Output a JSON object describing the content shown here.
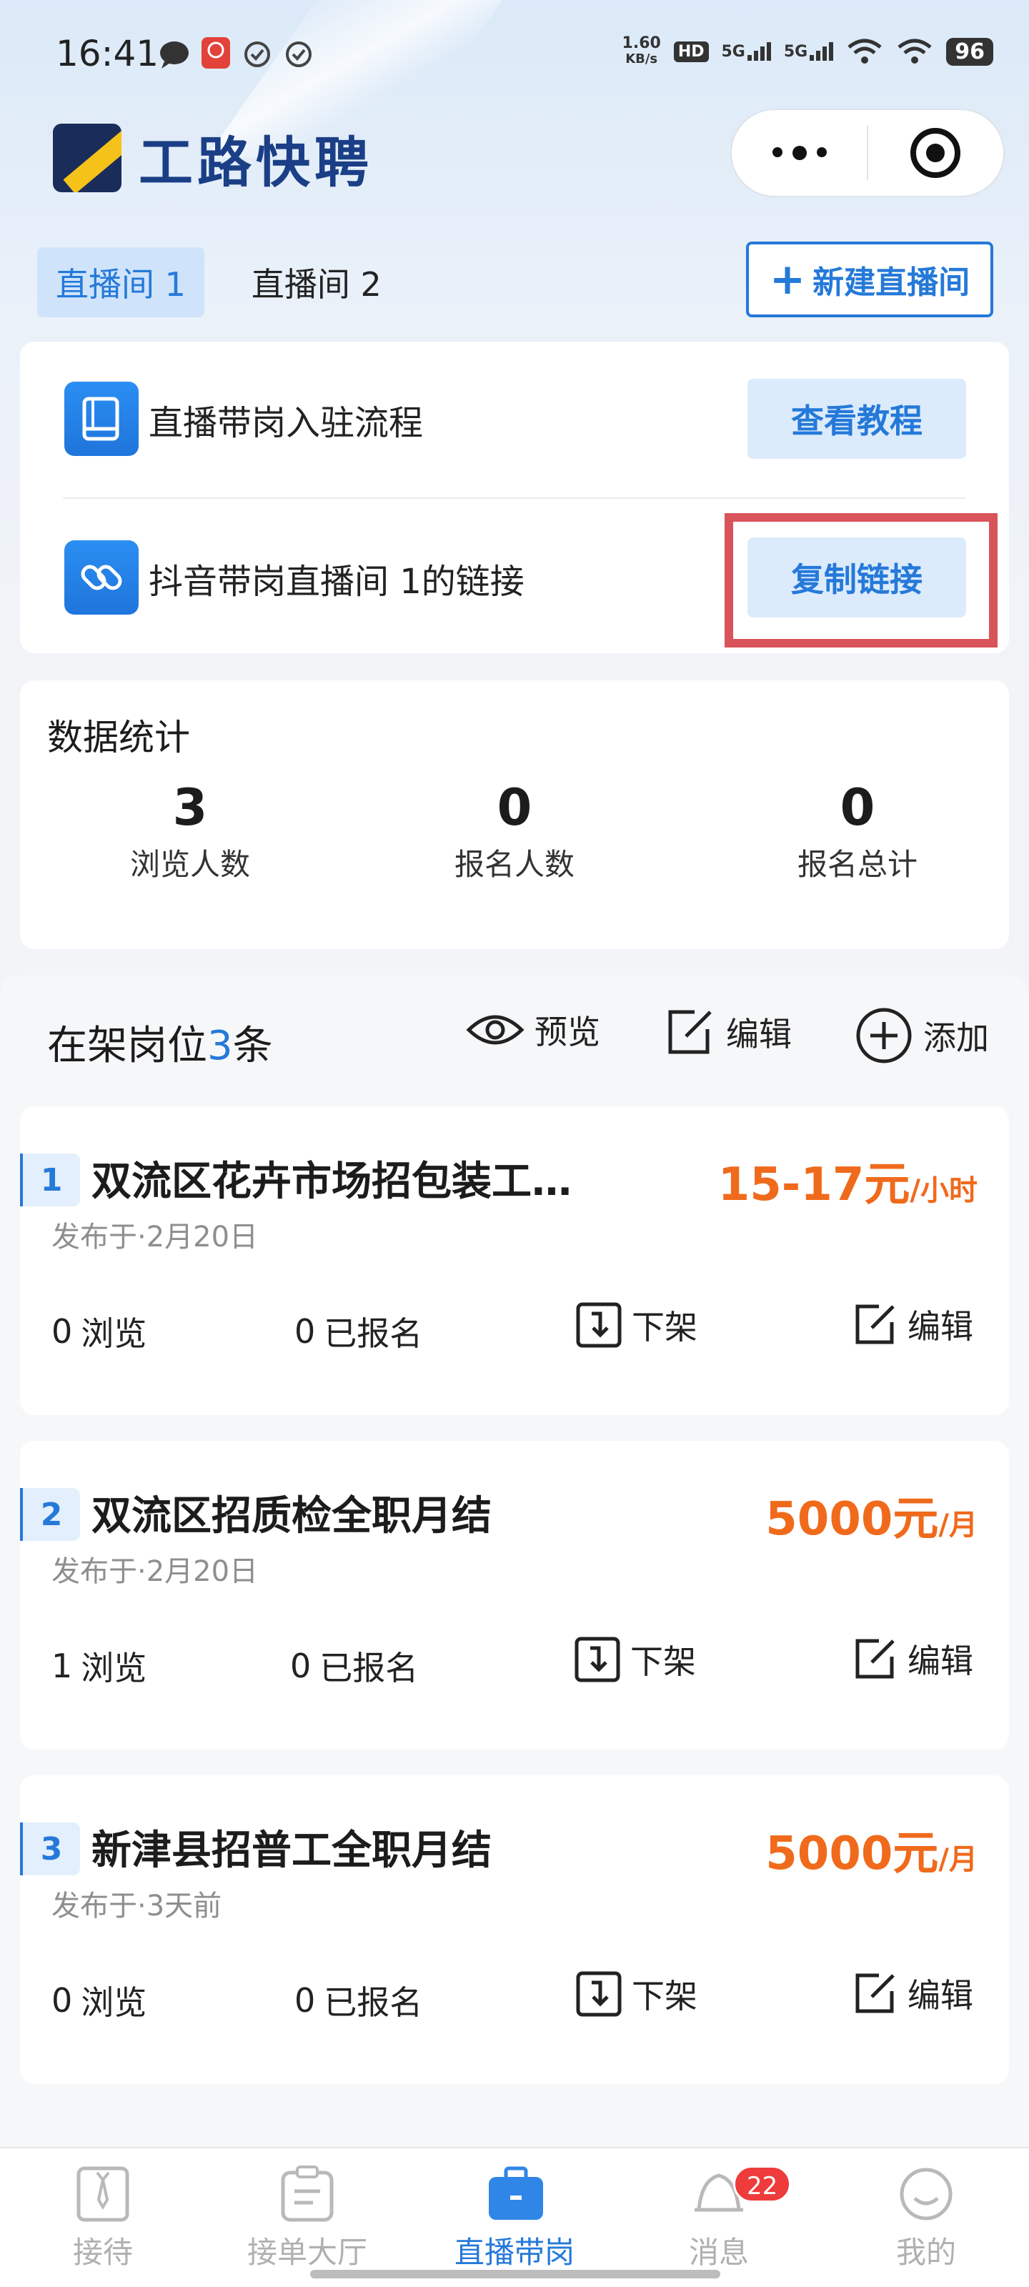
{
  "status_bar": {
    "time": "16:41",
    "net_speed_value": "1.60",
    "net_speed_unit": "KB/s",
    "hd": "HD",
    "signal_1": "5G",
    "signal_2": "5G",
    "battery": "96"
  },
  "header": {
    "logo_text": "工路快聘",
    "more_icon": "more-dots-icon",
    "close_icon": "target-icon"
  },
  "rooms": {
    "tabs": [
      "直播间 1",
      "直播间 2"
    ],
    "active_index": 0,
    "new_room_label": "新建直播间"
  },
  "links_card": {
    "row1_label": "直播带岗入驻流程",
    "row1_button": "查看教程",
    "row2_label": "抖音带岗直播间 1的链接",
    "row2_button": "复制链接"
  },
  "stats": {
    "title": "数据统计",
    "items": [
      {
        "value": "3",
        "label": "浏览人数"
      },
      {
        "value": "0",
        "label": "报名人数"
      },
      {
        "value": "0",
        "label": "报名总计"
      }
    ]
  },
  "jobs": {
    "title_prefix": "在架岗位",
    "count": "3",
    "title_suffix": "条",
    "preview_label": "预览",
    "edit_label": "编辑",
    "add_label": "添加",
    "list": [
      {
        "num": "1",
        "title": "双流区花卉市场招包装工…",
        "date": "发布于·2月20日",
        "salary": "15-17元",
        "unit": "/小时",
        "views": "0",
        "views_label": "浏览",
        "signups": "0",
        "signups_label": "已报名",
        "takedown": "下架",
        "edit": "编辑"
      },
      {
        "num": "2",
        "title": "双流区招质检全职月结",
        "date": "发布于·2月20日",
        "salary": "5000元",
        "unit": "/月",
        "views": "1",
        "views_label": "浏览",
        "signups": "0",
        "signups_label": "已报名",
        "takedown": "下架",
        "edit": "编辑"
      },
      {
        "num": "3",
        "title": "新津县招普工全职月结",
        "date": "发布于·3天前",
        "salary": "5000元",
        "unit": "/月",
        "views": "0",
        "views_label": "浏览",
        "signups": "0",
        "signups_label": "已报名",
        "takedown": "下架",
        "edit": "编辑"
      }
    ]
  },
  "bottom_nav": {
    "items": [
      "接待",
      "接单大厅",
      "直播带岗",
      "消息",
      "我的"
    ],
    "active_index": 2,
    "message_badge": "22"
  },
  "colors": {
    "accent": "#2579d9",
    "salary": "#f06a1c",
    "highlight": "#d9535a",
    "badge": "#ef3b3b"
  }
}
